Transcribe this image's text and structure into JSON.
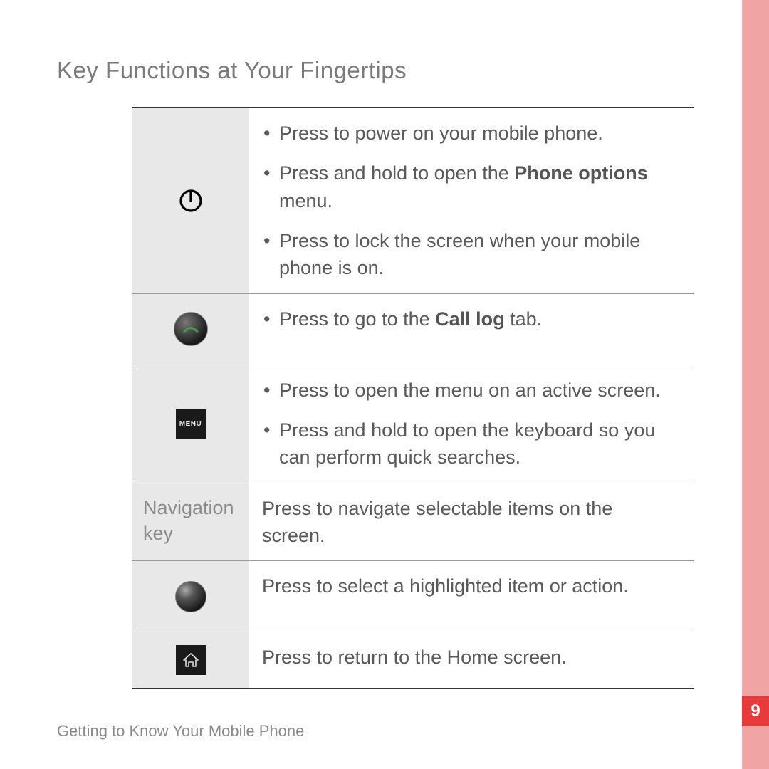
{
  "page": {
    "title": "Key Functions at Your Fingertips",
    "footer": "Getting to Know Your Mobile Phone",
    "number": "9"
  },
  "rows": [
    {
      "icon": "power-icon",
      "items": [
        {
          "pre": "Press to power on your mobile phone.",
          "bold": "",
          "post": ""
        },
        {
          "pre": "Press and hold to open the ",
          "bold": "Phone options",
          "post": " menu."
        },
        {
          "pre": "Press to lock the screen when your mobile phone is on.",
          "bold": "",
          "post": ""
        }
      ]
    },
    {
      "icon": "call-icon",
      "items": [
        {
          "pre": "Press to go to the ",
          "bold": "Call log",
          "post": " tab."
        }
      ]
    },
    {
      "icon": "menu-icon",
      "menu_label": "MENU",
      "items": [
        {
          "pre": "Press to open the menu on an active screen.",
          "bold": "",
          "post": ""
        },
        {
          "pre": "Press and hold to open the keyboard so you can perform quick searches.",
          "bold": "",
          "post": ""
        }
      ]
    },
    {
      "icon": "nav-label",
      "nav_text": "Navigation key",
      "plain": "Press to navigate selectable items on the screen."
    },
    {
      "icon": "trackball-icon",
      "plain": "Press to select a highlighted item or action."
    },
    {
      "icon": "home-icon",
      "plain": "Press to return to the Home screen."
    }
  ]
}
